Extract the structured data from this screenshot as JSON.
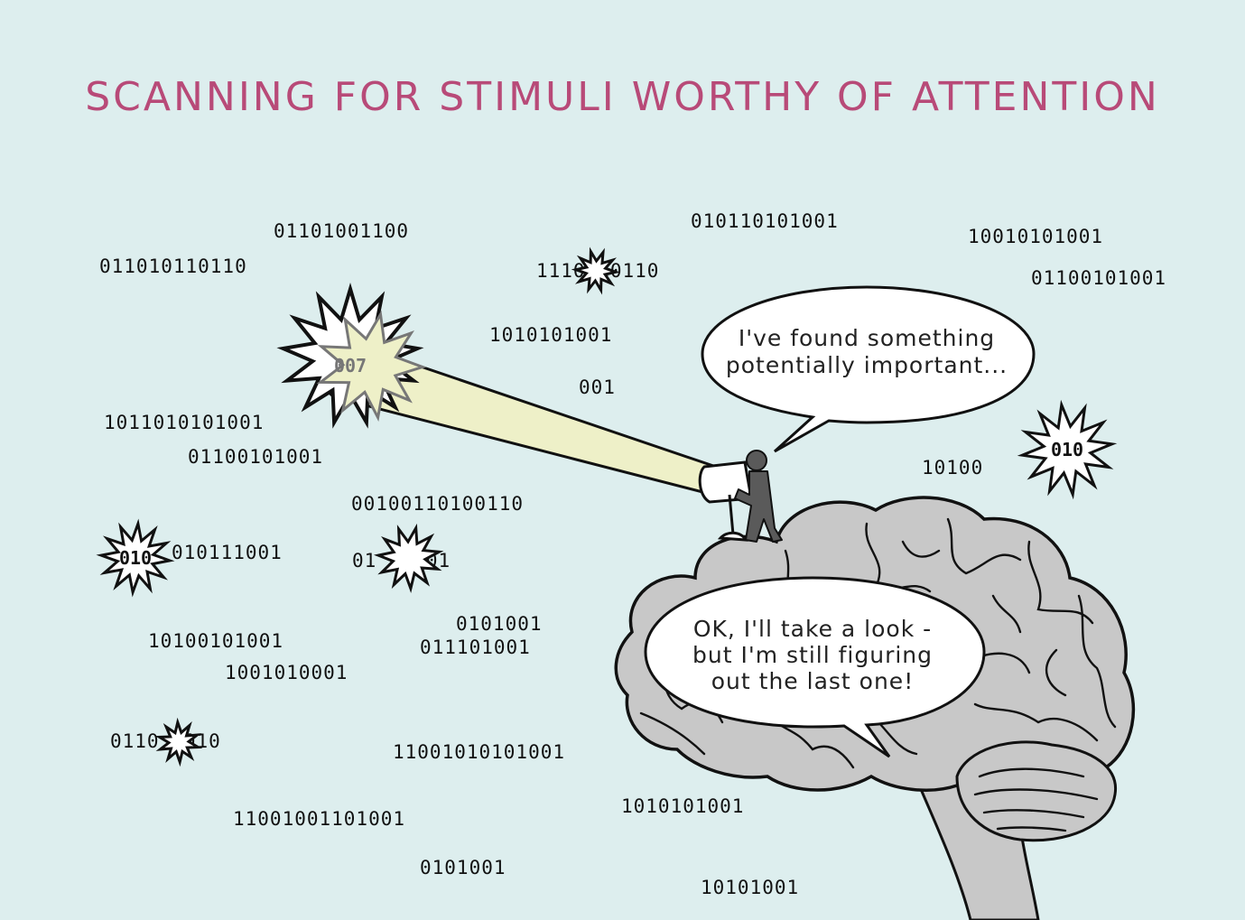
{
  "title": "SCANNING FOR STIMULI WORTHY OF ATTENTION",
  "colors": {
    "background": "#ddeeee",
    "title": "#b84a78",
    "brain": "#c8c8c8",
    "beam": "#eef0c8",
    "person": "#5a5a5a"
  },
  "binary_strings": [
    "01101001100",
    "011010110110",
    "010110101001",
    "10010101001",
    "01100101001",
    "1110  10110",
    "1010101001",
    "001",
    "1011010101001",
    "01100101001",
    "10100",
    "00100110100110",
    "010111001",
    "01  01  01",
    "0101001",
    "10100101001",
    "011101001",
    "1001010001",
    "0110   1010",
    "11001010101001",
    "1010101001",
    "11001001101001",
    "0101001",
    "10101001"
  ],
  "burst_labels": [
    "007",
    "010",
    "010"
  ],
  "icons": [
    "spotlight-icon",
    "person-icon",
    "brain-icon",
    "starburst-icon"
  ],
  "bubbles": {
    "top": {
      "lines": [
        "I've found something",
        "potentially important..."
      ]
    },
    "bottom": {
      "lines": [
        "OK, I'll take a look -",
        "but I'm still figuring",
        "out the last one!"
      ]
    }
  }
}
